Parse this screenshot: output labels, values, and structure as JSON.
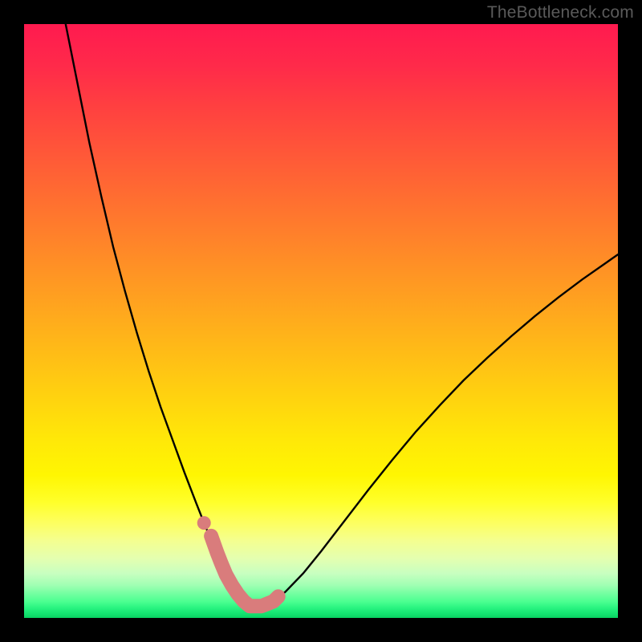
{
  "watermark": "TheBottleneck.com",
  "chart_data": {
    "type": "line",
    "title": "",
    "xlabel": "",
    "ylabel": "",
    "xlim": [
      0,
      100
    ],
    "ylim": [
      0,
      100
    ],
    "grid": false,
    "series": [
      {
        "name": "bottleneck-curve",
        "x": [
          7,
          9,
          11,
          13,
          15,
          17,
          19,
          21,
          23,
          25,
          27,
          29,
          30.5,
          32,
          33,
          34,
          35,
          36,
          37,
          38,
          40,
          42,
          44,
          47,
          50,
          54,
          58,
          62,
          66,
          70,
          74,
          78,
          82,
          86,
          90,
          94,
          98,
          100
        ],
        "y": [
          100,
          90,
          80,
          71,
          62.5,
          55,
          48,
          41.5,
          35.5,
          30,
          24.5,
          19.3,
          15.5,
          12,
          9.5,
          7.3,
          5.5,
          4,
          2.8,
          2,
          2,
          2.8,
          4.4,
          7.5,
          11.2,
          16.4,
          21.6,
          26.6,
          31.4,
          35.8,
          40,
          43.8,
          47.4,
          50.8,
          54,
          57,
          59.8,
          61.2
        ]
      }
    ],
    "highlight_segment": {
      "name": "bottleneck-highlight",
      "x": [
        31.5,
        32.5,
        33.2,
        34,
        35,
        36,
        37,
        38,
        39,
        40,
        41,
        42,
        42.8
      ],
      "y": [
        13.8,
        11,
        9.2,
        7.3,
        5.5,
        4,
        2.8,
        2,
        2,
        2,
        2.4,
        2.8,
        3.6
      ]
    },
    "highlight_point": {
      "x": 30.3,
      "y": 16.0
    },
    "highlight_color": "#d97c7c",
    "curve_color": "#000000"
  }
}
